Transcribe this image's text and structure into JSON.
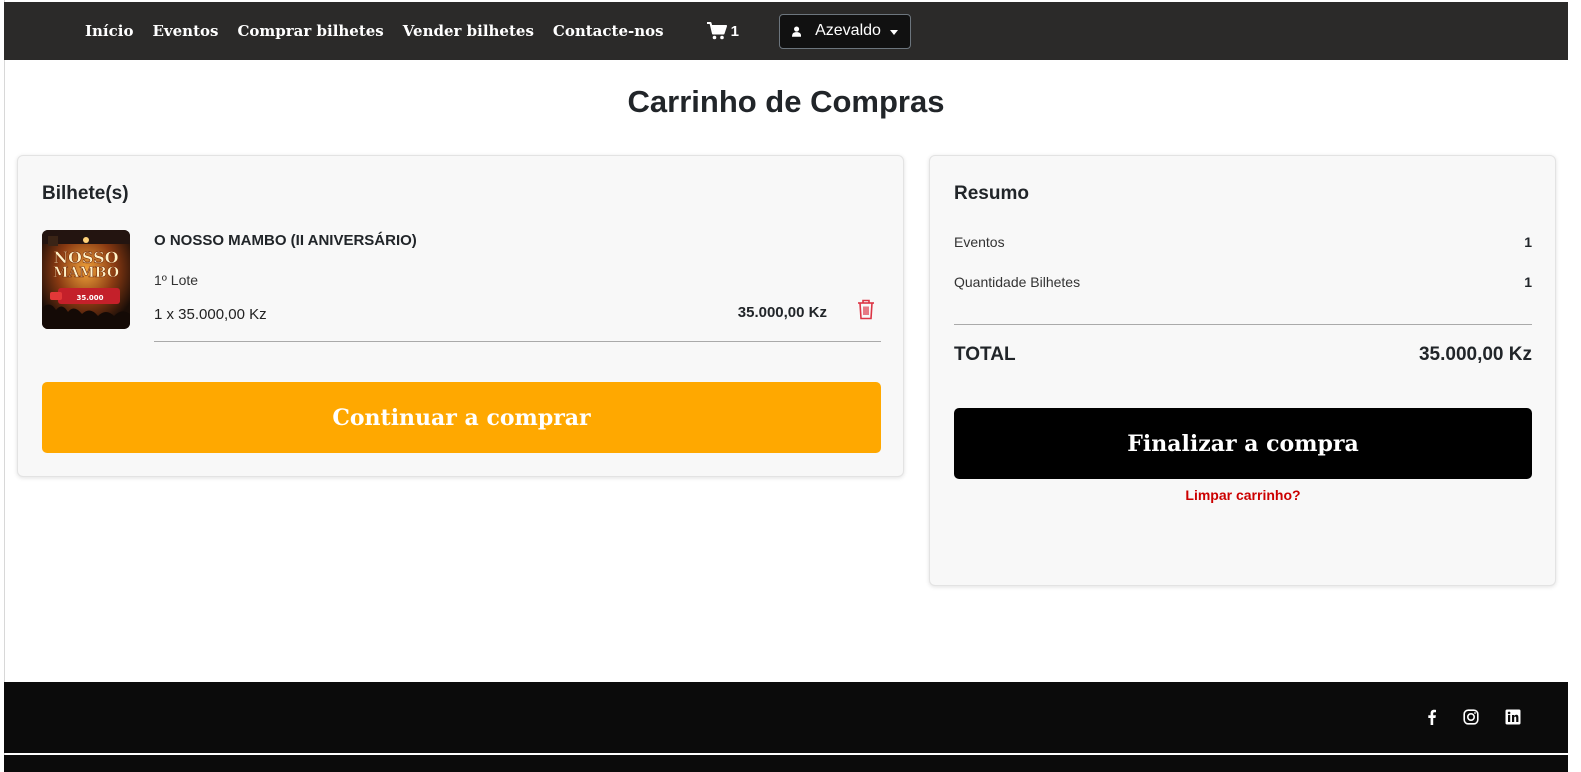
{
  "navbar": {
    "links": [
      "Início",
      "Eventos",
      "Comprar bilhetes",
      "Vender bilhetes",
      "Contacte-nos"
    ],
    "cart_count": "1",
    "user_name": "Azevaldo"
  },
  "page_title": "Carrinho de Compras",
  "tickets": {
    "heading": "Bilhete(s)",
    "item": {
      "name": "O NOSSO MAMBO (II ANIVERSÁRIO)",
      "lot": "1º Lote",
      "quantity_line": "1 x 35.000,00 Kz",
      "price": "35.000,00 Kz"
    },
    "continue_label": "Continuar a comprar"
  },
  "summary": {
    "heading": "Resumo",
    "events_label": "Eventos",
    "events_value": "1",
    "qty_label": "Quantidade Bilhetes",
    "qty_value": "1",
    "total_label": "TOTAL",
    "total_value": "35.000,00 Kz",
    "finalize_label": "Finalizar a compra",
    "clear_label": "Limpar carrinho?"
  },
  "colors": {
    "navbar_bg": "#2b2a29",
    "continue_btn": "#ffa800",
    "finalize_btn": "#000000",
    "clear_link": "#cc0000",
    "trash_icon": "#dc3545"
  },
  "icons": {
    "cart": "shopping-cart-icon",
    "user": "user-icon",
    "trash": "trash-icon",
    "social": [
      "facebook-icon",
      "instagram-icon",
      "linkedin-icon"
    ]
  }
}
